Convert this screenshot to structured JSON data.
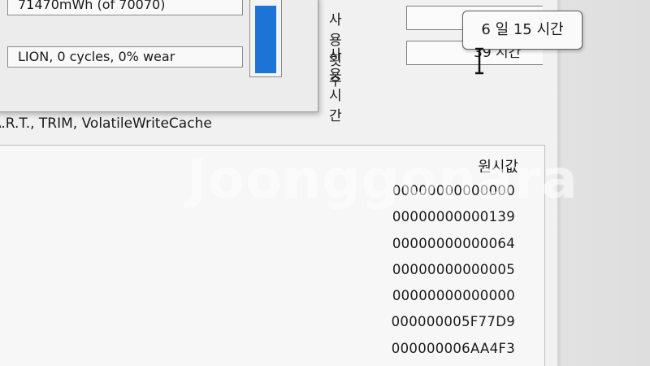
{
  "battery": {
    "capacity_text": "71470mWh (of 70070)",
    "chemistry_text": "LION, 0 cycles, 0% wear",
    "level_fraction": 0.92,
    "bar_color": "#1e74d6"
  },
  "features_text": "A.R.T., TRIM, VolatileWriteCache",
  "usage": {
    "count_label": "사용 횟수",
    "count_value": "",
    "time_label": "사용 시간",
    "time_value": "39 시간"
  },
  "tooltip": {
    "text": "6 일 15 시간"
  },
  "smart": {
    "raw_header": "원시값",
    "raw_values": [
      "00000000000000",
      "00000000000139",
      "00000000000064",
      "00000000000005",
      "00000000000000",
      "000000005F77D9",
      "000000006AA4F3"
    ]
  },
  "watermark": "Joonggonara",
  "icons": {
    "cursor": "text-cursor-icon"
  }
}
